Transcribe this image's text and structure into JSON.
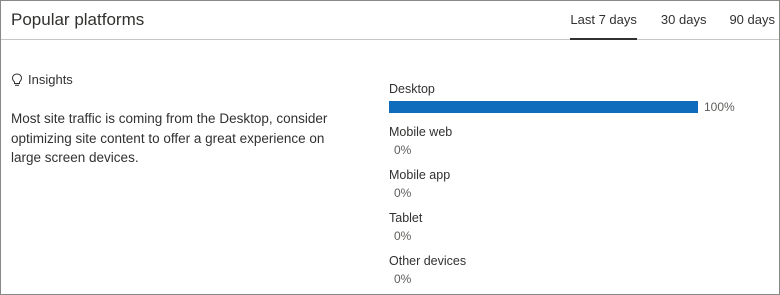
{
  "card": {
    "title": "Popular platforms",
    "tabs": [
      {
        "label": "Last 7 days",
        "active": true
      },
      {
        "label": "30 days",
        "active": false
      },
      {
        "label": "90 days",
        "active": false
      }
    ]
  },
  "insights": {
    "icon": "lightbulb-icon",
    "heading": "Insights",
    "text": "Most site traffic is coming from the Desktop, consider optimizing site content to offer a great experience on large screen devices."
  },
  "platforms": [
    {
      "label": "Desktop",
      "percent_text": "100%",
      "value": 100
    },
    {
      "label": "Mobile web",
      "percent_text": "0%",
      "value": 0
    },
    {
      "label": "Mobile app",
      "percent_text": "0%",
      "value": 0
    },
    {
      "label": "Tablet",
      "percent_text": "0%",
      "value": 0
    },
    {
      "label": "Other devices",
      "percent_text": "0%",
      "value": 0
    }
  ],
  "colors": {
    "bar": "#0f6cbd",
    "text": "#323130",
    "border": "#8a8886"
  }
}
